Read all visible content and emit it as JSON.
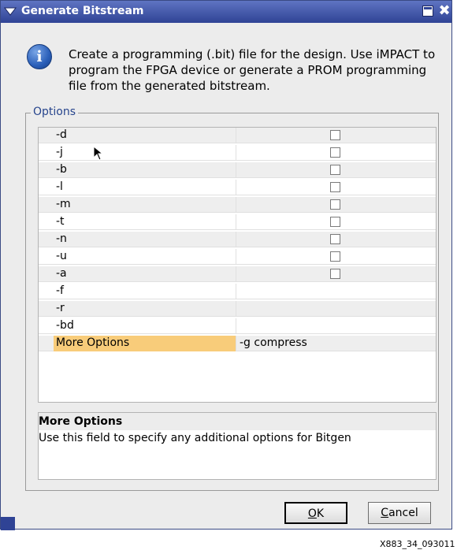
{
  "window": {
    "title": "Generate Bitstream",
    "close_glyph": "✖"
  },
  "description": "Create a programming (.bit) file for the design. Use iMPACT to program the FPGA device or generate a PROM programming file from the generated bitstream.",
  "info_icon_letter": "i",
  "options": {
    "legend": "Options",
    "rows": [
      {
        "name": "-d",
        "checkbox": true
      },
      {
        "name": "-j",
        "checkbox": true
      },
      {
        "name": "-b",
        "checkbox": true
      },
      {
        "name": "-l",
        "checkbox": true
      },
      {
        "name": "-m",
        "checkbox": true
      },
      {
        "name": "-t",
        "checkbox": true
      },
      {
        "name": "-n",
        "checkbox": true
      },
      {
        "name": "-u",
        "checkbox": true
      },
      {
        "name": "-a",
        "checkbox": true
      },
      {
        "name": "-f",
        "checkbox": false
      },
      {
        "name": "-r",
        "checkbox": false
      },
      {
        "name": "-bd",
        "checkbox": false
      },
      {
        "name": "More Options",
        "checkbox": false,
        "value": "-g compress",
        "selected": true
      }
    ]
  },
  "help": {
    "title": "More Options",
    "text": "Use this field to specify any additional options for Bitgen"
  },
  "buttons": {
    "ok": "OK",
    "ok_mnemonic": "O",
    "ok_rest": "K",
    "cancel_mnemonic": "C",
    "cancel_rest": "ancel"
  },
  "caption": "X883_34_093011",
  "colors": {
    "titlebar": "#2f4395",
    "selected_row": "#f8cc7a",
    "legend_text": "#27458d"
  }
}
